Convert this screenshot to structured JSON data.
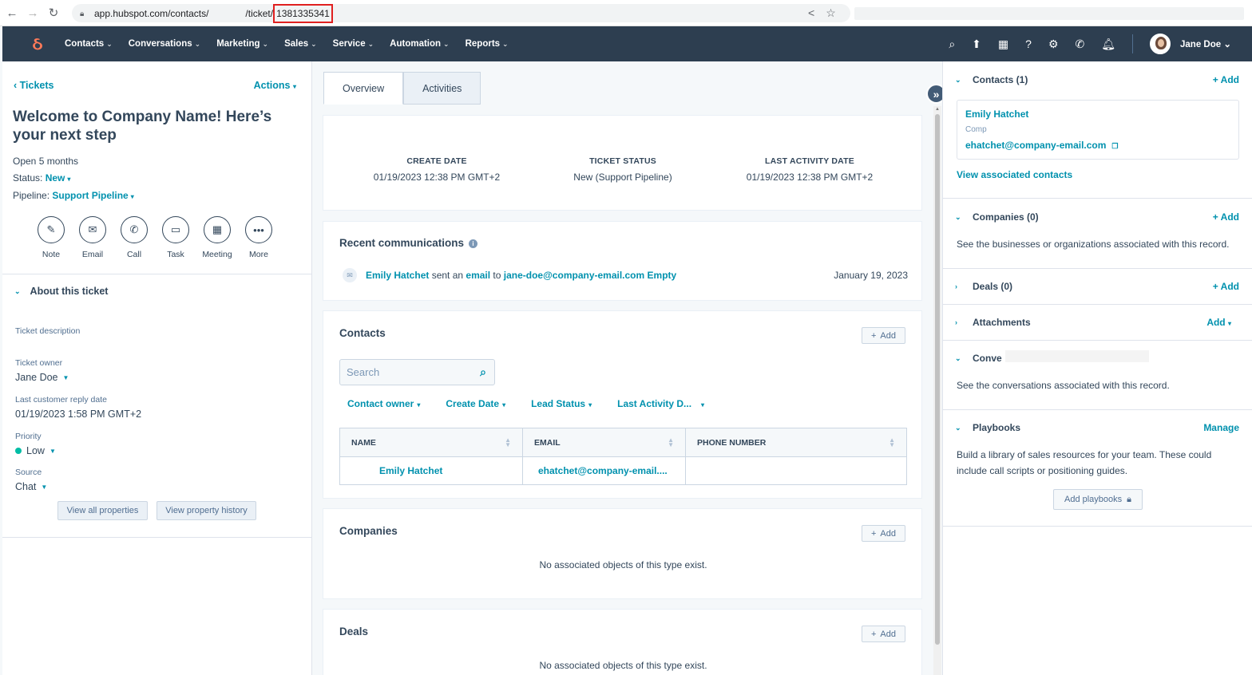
{
  "browser": {
    "url_main": "app.hubspot.com/contacts/",
    "url_path": "/ticket/",
    "url_id": "1381335341"
  },
  "topnav": {
    "menu": [
      "Contacts",
      "Conversations",
      "Marketing",
      "Sales",
      "Service",
      "Automation",
      "Reports"
    ],
    "user": "Jane Doe"
  },
  "left": {
    "back_label": "Tickets",
    "actions_label": "Actions",
    "title": "Welcome to Company Name! Here’s your next step",
    "open_duration": "Open 5 months",
    "status_label": "Status:",
    "status_value": "New",
    "pipeline_label": "Pipeline:",
    "pipeline_value": "Support Pipeline",
    "quick_actions": [
      "Note",
      "Email",
      "Call",
      "Task",
      "Meeting",
      "More"
    ],
    "about_title": "About this ticket",
    "ticket_description_label": "Ticket description",
    "owner_label": "Ticket owner",
    "owner_value": "Jane Doe",
    "last_reply_label": "Last customer reply date",
    "last_reply_value": "01/19/2023 1:58 PM GMT+2",
    "priority_label": "Priority",
    "priority_value": "Low",
    "source_label": "Source",
    "source_value": "Chat",
    "view_all_btn": "View all properties",
    "view_history_btn": "View property history"
  },
  "middle": {
    "tabs": [
      "Overview",
      "Activities"
    ],
    "stats": [
      {
        "label": "CREATE DATE",
        "value": "01/19/2023 12:38 PM GMT+2"
      },
      {
        "label": "TICKET STATUS",
        "value": "New (Support Pipeline)"
      },
      {
        "label": "LAST ACTIVITY DATE",
        "value": "01/19/2023 12:38 PM GMT+2"
      }
    ],
    "recent_title": "Recent communications",
    "comm": {
      "sender": "Emily Hatchet",
      "text1": " sent an ",
      "type": "email",
      "text2": " to ",
      "recipient": "jane-doe@company-email.com",
      "subject": " Empty",
      "date": "January 19, 2023"
    },
    "contacts_title": "Contacts",
    "add_label": "Add",
    "search_placeholder": "Search",
    "filters": [
      "Contact owner",
      "Create Date",
      "Lead Status",
      "Last Activity D..."
    ],
    "table_headers": [
      "NAME",
      "EMAIL",
      "PHONE NUMBER"
    ],
    "table_rows": [
      [
        "Emily Hatchet",
        "ehatchet@company-email....",
        ""
      ]
    ],
    "companies_title": "Companies",
    "companies_empty": "No associated objects of this type exist.",
    "deals_title": "Deals",
    "deals_empty": "No associated objects of this type exist."
  },
  "right": {
    "contacts_title": "Contacts (1)",
    "contacts_add": "+ Add",
    "contact_name": "Emily Hatchet",
    "contact_company": "Comp",
    "contact_email": "ehatchet@company-email.com",
    "view_associated": "View associated contacts",
    "companies_title": "Companies (0)",
    "companies_add": "+ Add",
    "companies_text": "See the businesses or organizations associated with this record.",
    "deals_title": "Deals (0)",
    "deals_add": "+ Add",
    "attachments_title": "Attachments",
    "attachments_add": "Add",
    "conversations_title": "Conve",
    "conversations_text": "See the conversations associated with this record.",
    "playbooks_title": "Playbooks",
    "playbooks_manage": "Manage",
    "playbooks_text": "Build a library of sales resources for your team. These could include call scripts or positioning guides.",
    "add_playbooks_btn": "Add playbooks"
  }
}
